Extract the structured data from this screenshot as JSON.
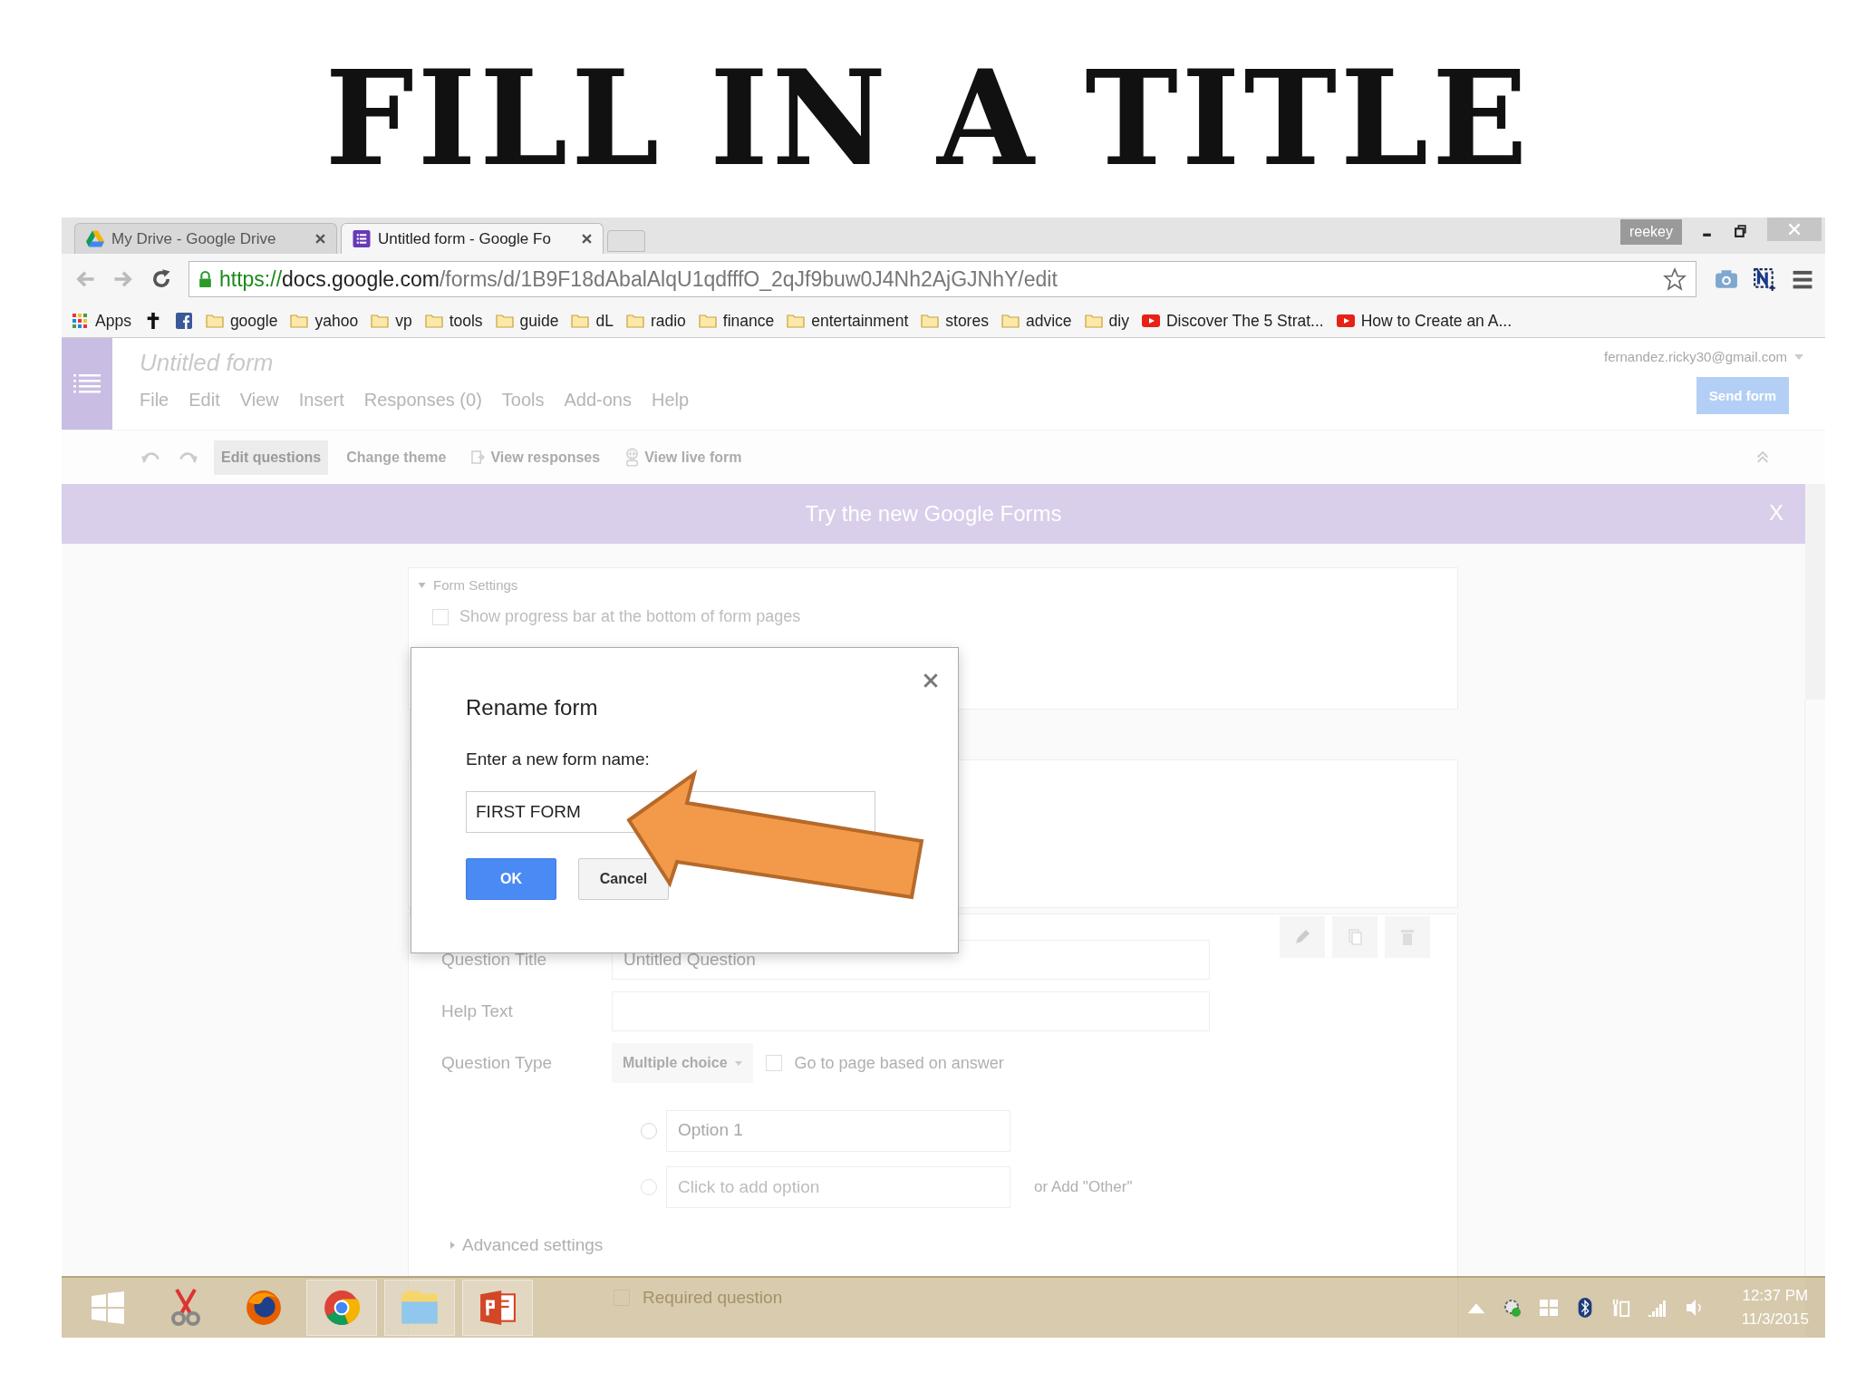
{
  "slide_title": "FILL IN A TITLE",
  "browser": {
    "tabs": [
      {
        "label": "My Drive - Google Drive",
        "kind": "drive",
        "selected": false
      },
      {
        "label": "Untitled form - Google Fo",
        "kind": "forms",
        "selected": true
      }
    ],
    "profile": "reekey",
    "url": {
      "scheme": "https://",
      "host": "docs.google.com",
      "path": "/forms/d/1B9F18dAbalAlqU1qdfffO_2qJf9buw0J4Nh2AjGJNhY/edit"
    },
    "bookmarks": [
      {
        "kind": "apps",
        "label": "Apps"
      },
      {
        "kind": "cross"
      },
      {
        "kind": "facebook"
      },
      {
        "kind": "folder",
        "label": "google"
      },
      {
        "kind": "folder",
        "label": "yahoo"
      },
      {
        "kind": "folder",
        "label": "vp"
      },
      {
        "kind": "folder",
        "label": "tools"
      },
      {
        "kind": "folder",
        "label": "guide"
      },
      {
        "kind": "folder",
        "label": "dL"
      },
      {
        "kind": "folder",
        "label": "radio"
      },
      {
        "kind": "folder",
        "label": "finance"
      },
      {
        "kind": "folder",
        "label": "entertainment"
      },
      {
        "kind": "folder",
        "label": "stores"
      },
      {
        "kind": "folder",
        "label": "advice"
      },
      {
        "kind": "folder",
        "label": "diy"
      },
      {
        "kind": "video",
        "label": "Discover The 5 Strat..."
      },
      {
        "kind": "video",
        "label": "How to Create an A..."
      }
    ]
  },
  "form_app": {
    "title": "Untitled form",
    "menu": [
      "File",
      "Edit",
      "View",
      "Insert",
      "Responses (0)",
      "Tools",
      "Add-ons",
      "Help"
    ],
    "account": "fernandez.ricky30@gmail.com",
    "send_button": "Send form",
    "toolbar": [
      {
        "label": "Edit questions",
        "kind": "plain",
        "selected": true
      },
      {
        "label": "Change theme",
        "kind": "plain",
        "selected": false
      },
      {
        "label": "View responses",
        "kind": "responses",
        "selected": false
      },
      {
        "label": "View live form",
        "kind": "live",
        "selected": false
      }
    ],
    "banner": {
      "text": "Try the new Google Forms",
      "close": "X"
    }
  },
  "form_settings": {
    "heading": "Form Settings",
    "options": [
      {
        "label": "Show progress bar at the bottom of form pages",
        "checked": false
      }
    ]
  },
  "question": {
    "fields": [
      {
        "label": "Question Title",
        "value": "Untitled Question"
      },
      {
        "label": "Help Text"
      }
    ],
    "type_label": "Question Type",
    "type_value": "Multiple choice",
    "go_to_page": {
      "label": "Go to page based on answer",
      "checked": false
    },
    "options": [
      {
        "value": "Option 1",
        "selected": false
      }
    ],
    "add_option": {
      "placeholder": "Click to add option",
      "selected": false
    },
    "add_other": "or Add \"Other\"",
    "advanced": "Advanced settings",
    "required": {
      "label": "Required question",
      "checked": false
    }
  },
  "dialog": {
    "title": "Rename form",
    "prompt": "Enter a new form name:",
    "value": "FIRST FORM",
    "buttons": [
      {
        "label": "OK",
        "kind": "primary"
      },
      {
        "label": "Cancel",
        "kind": "secondary"
      }
    ]
  },
  "taskbar": {
    "apps": [
      {
        "kind": "start",
        "running": false
      },
      {
        "kind": "scissors",
        "running": false
      },
      {
        "kind": "firefox",
        "running": false
      },
      {
        "kind": "chrome",
        "running": true
      },
      {
        "kind": "explorer",
        "running": true
      },
      {
        "kind": "powerpoint",
        "running": true
      }
    ],
    "time": "12:37 PM",
    "date": "11/3/2015"
  }
}
